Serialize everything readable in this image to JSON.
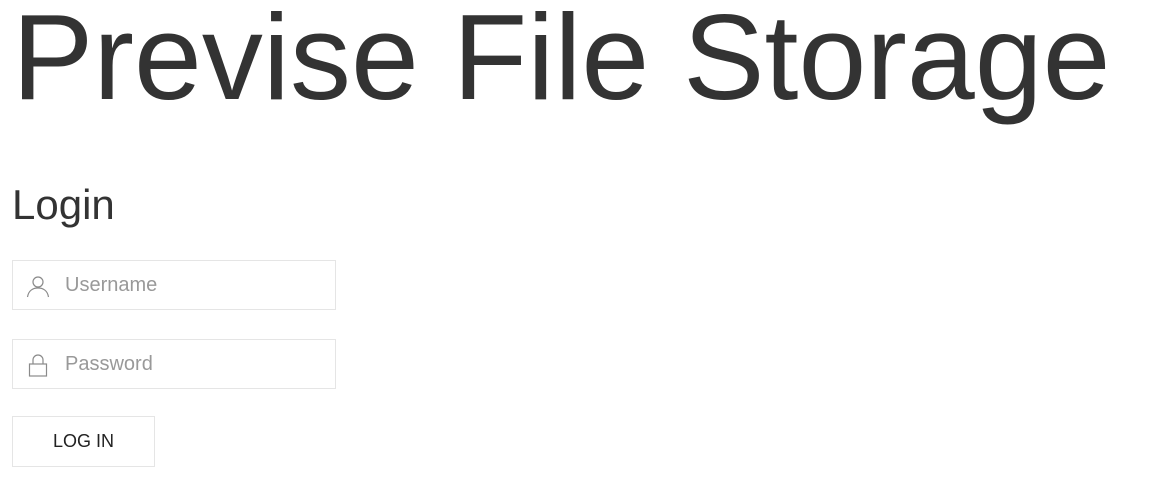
{
  "header": {
    "title": "Previse File Storage"
  },
  "login": {
    "heading": "Login",
    "username": {
      "placeholder": "Username",
      "value": "",
      "icon": "user-icon"
    },
    "password": {
      "placeholder": "Password",
      "value": "",
      "icon": "lock-icon"
    },
    "submit_label": "LOG IN"
  },
  "colors": {
    "text": "#333333",
    "placeholder": "#999999",
    "border": "#e5e5e5",
    "background": "#ffffff"
  }
}
